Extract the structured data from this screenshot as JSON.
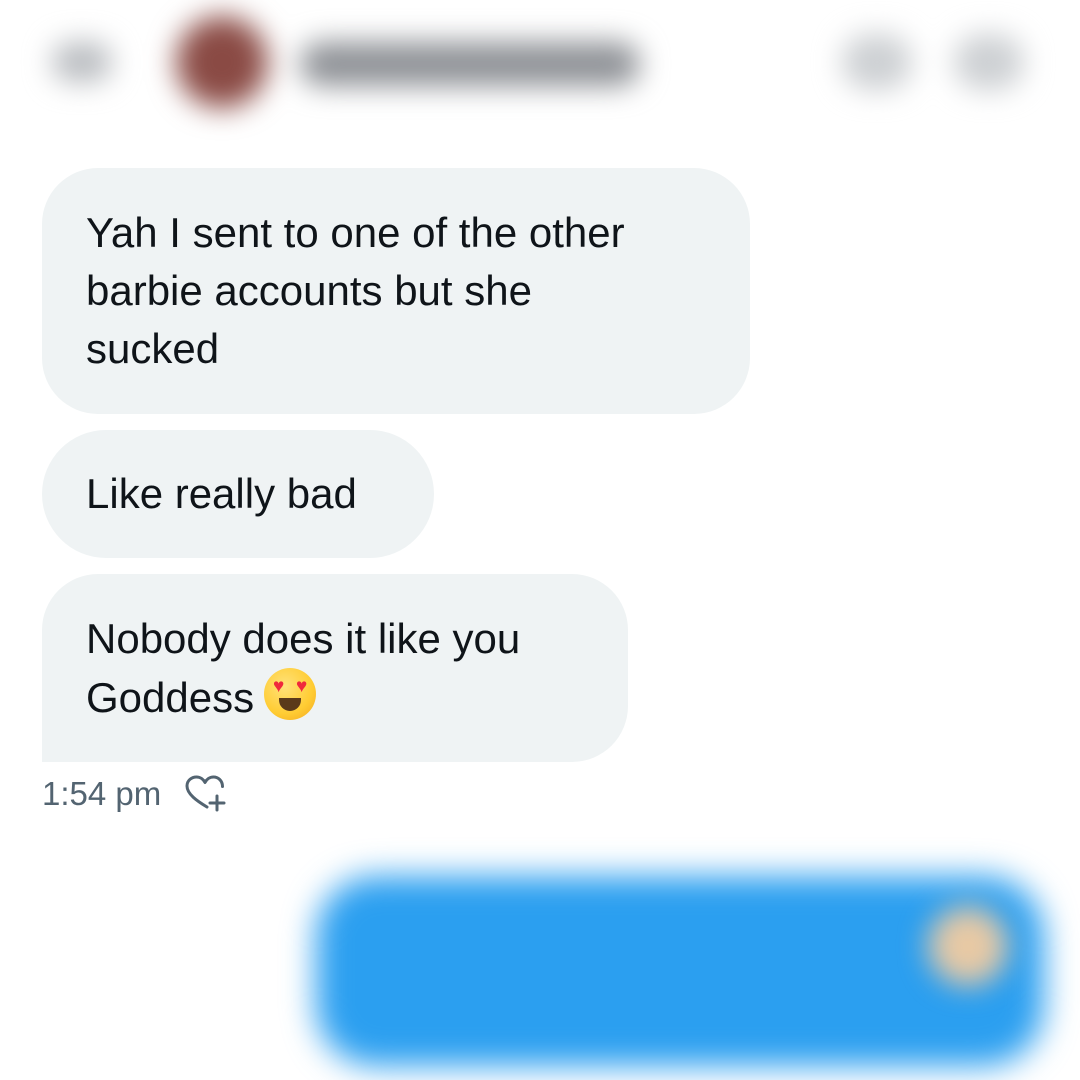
{
  "header": {
    "contact_name": "",
    "back_icon": "back-arrow-icon",
    "actions": [
      "info-icon",
      "more-icon"
    ]
  },
  "messages": [
    {
      "text": "Yah I sent to one of the other\nbarbie accounts but she\nsucked"
    },
    {
      "text": "Like really bad"
    },
    {
      "text": "Nobody does it like you\nGoddess",
      "emoji": "smiling-face-with-heart-eyes-icon"
    }
  ],
  "meta": {
    "timestamp": "1:54 pm",
    "react_icon": "add-reaction-heart-icon"
  },
  "outgoing": {
    "text": ""
  },
  "colors": {
    "incoming_bubble": "#eff3f4",
    "outgoing_bubble": "#2b9ff0",
    "text": "#0f1419",
    "muted": "#536471"
  }
}
